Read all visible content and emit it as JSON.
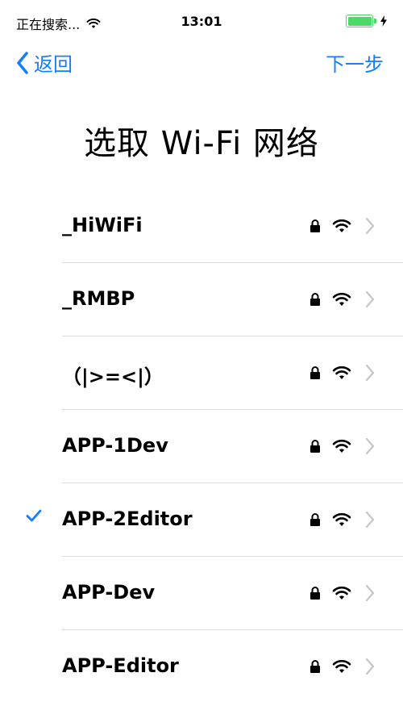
{
  "status_bar": {
    "carrier": "正在搜索...",
    "time": "13:01"
  },
  "nav": {
    "back_label": "返回",
    "next_label": "下一步"
  },
  "title": "选取 Wi-Fi 网络",
  "networks": [
    {
      "name": "_HiWiFi",
      "selected": false,
      "secured": true
    },
    {
      "name": "_RMBP",
      "selected": false,
      "secured": true
    },
    {
      "name": "（|>=<|）",
      "selected": false,
      "secured": true
    },
    {
      "name": "APP-1Dev",
      "selected": false,
      "secured": true
    },
    {
      "name": "APP-2Editor",
      "selected": true,
      "secured": true
    },
    {
      "name": "APP-Dev",
      "selected": false,
      "secured": true
    },
    {
      "name": "APP-Editor",
      "selected": false,
      "secured": true
    }
  ],
  "colors": {
    "accent": "#157efb",
    "battery": "#4cd964",
    "divider": "#d9d9d9",
    "chevron": "#c7c7cc"
  },
  "icons": {
    "wifi": "wifi-icon",
    "lock": "lock-icon",
    "checkmark": "checkmark-icon",
    "chevron": "chevron-right-icon",
    "back": "chevron-left-icon",
    "battery": "battery-icon",
    "charging": "bolt-icon"
  }
}
